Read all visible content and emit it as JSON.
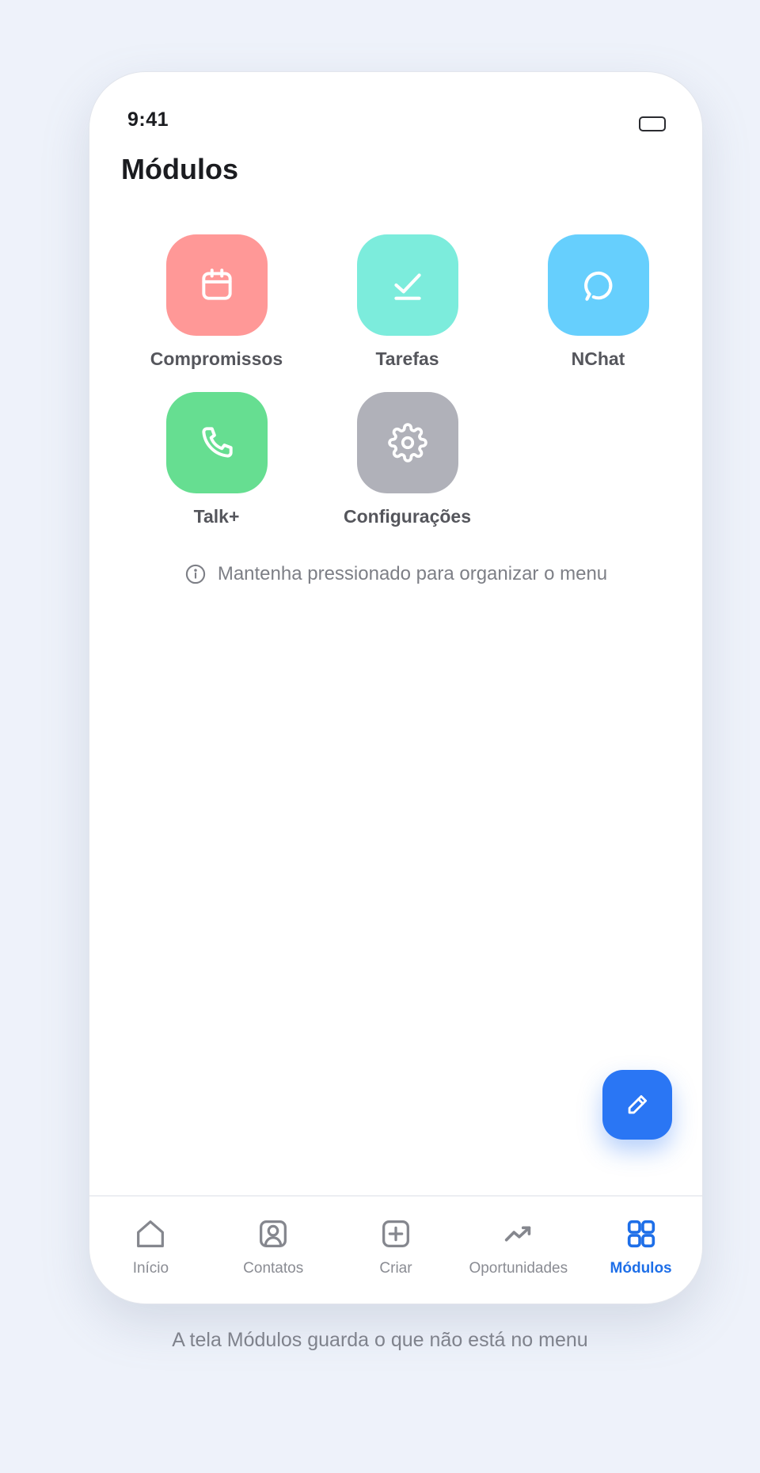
{
  "status_bar": {
    "time": "9:41"
  },
  "header": {
    "title": "Módulos"
  },
  "modules": [
    {
      "label": "Compromissos",
      "icon": "calendar-icon",
      "color": "#ff9897"
    },
    {
      "label": "Tarefas",
      "icon": "check-icon",
      "color": "#7cecdc"
    },
    {
      "label": "NChat",
      "icon": "chat-icon",
      "color": "#66cffd"
    },
    {
      "label": "Talk+",
      "icon": "phone-icon",
      "color": "#66de91"
    },
    {
      "label": "Configurações",
      "icon": "gear-icon",
      "color": "#b0b1b9"
    }
  ],
  "hint": {
    "text": "Mantenha pressionado para organizar o menu",
    "icon": "info-icon"
  },
  "fab": {
    "icon": "pencil-icon",
    "color": "#2a76f4"
  },
  "tabbar": {
    "items": [
      {
        "label": "Início",
        "icon": "home-icon"
      },
      {
        "label": "Contatos",
        "icon": "contacts-icon"
      },
      {
        "label": "Criar",
        "icon": "plus-square-icon"
      },
      {
        "label": "Oportunidades",
        "icon": "trending-up-icon"
      },
      {
        "label": "Módulos",
        "icon": "grid-icon",
        "active": true
      }
    ],
    "active_color": "#1e6fe8"
  },
  "caption": "A tela Módulos guarda o que não está no menu"
}
